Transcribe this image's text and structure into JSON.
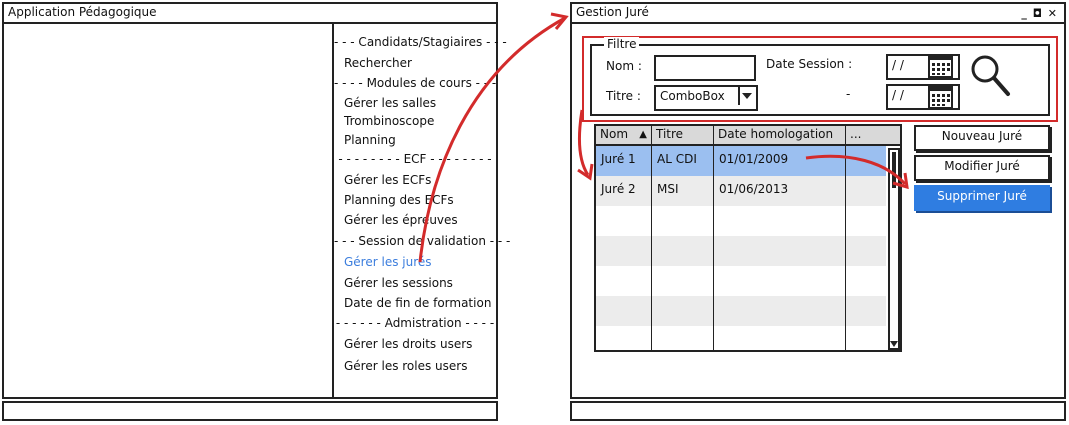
{
  "left_window": {
    "title": "Application Pédagogique",
    "menu": {
      "items": [
        {
          "type": "sep",
          "label": "- - - Candidats/Stagiaires - - -"
        },
        {
          "type": "item",
          "label": "Rechercher"
        },
        {
          "type": "sep",
          "label": "- - - - Modules de cours - - -"
        },
        {
          "type": "item",
          "label": "Gérer les salles"
        },
        {
          "type": "item",
          "label": "Trombinoscope"
        },
        {
          "type": "item",
          "label": "Planning"
        },
        {
          "type": "sep",
          "label": "- - - - - - - - ECF - - - - - - - -"
        },
        {
          "type": "item",
          "label": "Gérer les ECFs"
        },
        {
          "type": "item",
          "label": "Planning des ECFs"
        },
        {
          "type": "item",
          "label": "Gérer les épreuves"
        },
        {
          "type": "sep",
          "label": "- - - Session de validation - - -"
        },
        {
          "type": "item",
          "label": "Gérer les jurés",
          "active": true
        },
        {
          "type": "item",
          "label": "Gérer les sessions"
        },
        {
          "type": "item",
          "label": "Date de fin de formation"
        },
        {
          "type": "sep",
          "label": "- - - - - - Admistration - - - -"
        },
        {
          "type": "item",
          "label": "Gérer les droits users"
        },
        {
          "type": "item",
          "label": "Gérer les roles users"
        }
      ]
    }
  },
  "right_window": {
    "title": "Gestion Juré",
    "controls": "_ ◘ ✕",
    "filter": {
      "legend": "Filtre",
      "nom_label": "Nom :",
      "nom_value": "",
      "titre_label": "Titre :",
      "titre_value": "ComboBox",
      "date_session_label": "Date Session :",
      "date_from": " / /",
      "date_sep": "-",
      "date_to": " / /"
    },
    "grid": {
      "columns": [
        "Nom",
        "Titre",
        "Date homologation",
        "..."
      ],
      "sort_indicator": "▲",
      "rows": [
        {
          "nom": "Juré 1",
          "titre": "AL CDI",
          "date": "01/01/2009",
          "selected": true
        },
        {
          "nom": "Juré 2",
          "titre": "MSI",
          "date": "01/06/2013",
          "selected": false
        }
      ],
      "empty_rows": 5
    },
    "buttons": {
      "new": "Nouveau Juré",
      "edit": "Modifier Juré",
      "delete": "Supprimer Juré"
    }
  },
  "colors": {
    "arrow": "#d32b2b",
    "selection": "#9bbff0",
    "primary_button": "#2f7de1",
    "active_menu": "#3b7ddd"
  }
}
